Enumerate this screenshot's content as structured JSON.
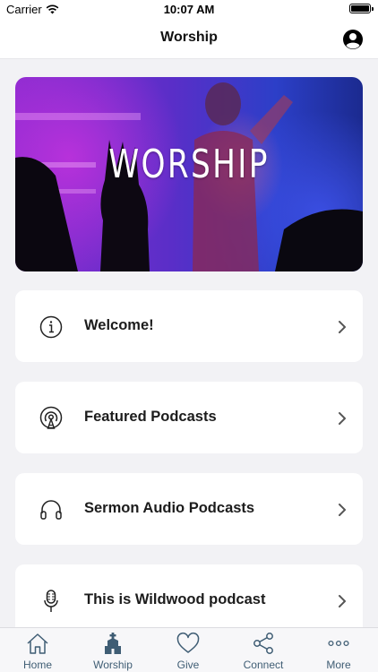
{
  "status_bar": {
    "carrier": "Carrier",
    "time": "10:07 AM"
  },
  "nav": {
    "title": "Worship",
    "profile_icon": "person-circle-icon"
  },
  "hero": {
    "title": "WORSHIP"
  },
  "list_items": [
    {
      "label": "Welcome!",
      "icon": "info-icon"
    },
    {
      "label": "Featured Podcasts",
      "icon": "podcast-icon"
    },
    {
      "label": "Sermon Audio Podcasts",
      "icon": "headphones-icon"
    },
    {
      "label": "This is Wildwood podcast",
      "icon": "microphone-icon"
    }
  ],
  "tabs": [
    {
      "label": "Home",
      "icon": "home-icon",
      "active": false
    },
    {
      "label": "Worship",
      "icon": "church-icon",
      "active": true
    },
    {
      "label": "Give",
      "icon": "heart-icon",
      "active": false
    },
    {
      "label": "Connect",
      "icon": "share-icon",
      "active": false
    },
    {
      "label": "More",
      "icon": "more-icon",
      "active": false
    }
  ],
  "colors": {
    "background": "#f2f2f5",
    "card": "#ffffff",
    "tab_tint": "#3f5d74",
    "hero_purple": "#8a2bd0",
    "hero_blue": "#2c3fc8"
  }
}
